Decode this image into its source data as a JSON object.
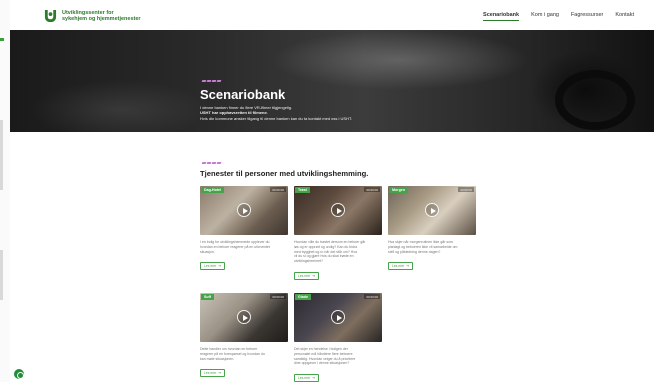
{
  "header": {
    "logo_line1": "Utviklingssenter for",
    "logo_line2": "sykehjem og hjemmetjenester",
    "nav": [
      "Scenariobank",
      "Kom i gang",
      "Fagressurser",
      "Kontakt"
    ],
    "active_nav": "Scenariobank"
  },
  "hero": {
    "title": "Scenariobank",
    "text": [
      "I denne banken finner du flere VR-filmer tilgjengelig.",
      "USHT har opphavsretten til filmene.",
      "Hvis din kommune ønsker tilgang til denne banken kan du ta kontakt med oss i USHT."
    ]
  },
  "section": {
    "title": "Tjenester til personer med utviklingshemming."
  },
  "cards": [
    {
      "tag": "Dag-Hotel",
      "duration": "00:00:00",
      "desc": [
        "I en bolig for utviklingshemmede opplever du",
        "hvordan en beboer reagerer på en uforventet",
        "situasjon."
      ],
      "button": "Les mer"
    },
    {
      "tag": "Trøst",
      "duration": "00:00:00",
      "desc": [
        "Hvordan ville du trøstet dersom en beboer går",
        "løs og er opprørt og urolig? Kan du bidra",
        "med trygghet og ro når det står om? Hva",
        "vil du si og gjøre hvis du skal trøste en",
        "utviklingshemmet?"
      ],
      "button": "Les mer"
    },
    {
      "tag": "Morgen",
      "duration": "00:00:00",
      "desc": [
        "Hva skjer når morgenrutinen ikke går som",
        "planlagt og beboeren ikke vil samarbeide om",
        "stell og påkledning denne dagen?"
      ],
      "button": "Les mer"
    },
    {
      "tag": "Suff",
      "duration": "00:00:00",
      "desc": [
        "Dette handler om hvordan en beboer",
        "reagerer på en forespørsel og hvordan du",
        "kan møte situasjonen."
      ],
      "button": "Les mer"
    },
    {
      "tag": "Glade",
      "duration": "00:00:00",
      "desc": [
        "Det skjer en hendelse i boligen der",
        "personalet må håndtere flere beboere",
        "samtidig. Hvordan velger du å prioritere",
        "dine oppgaver i denne situasjonen?"
      ],
      "button": "Les mer"
    }
  ]
}
